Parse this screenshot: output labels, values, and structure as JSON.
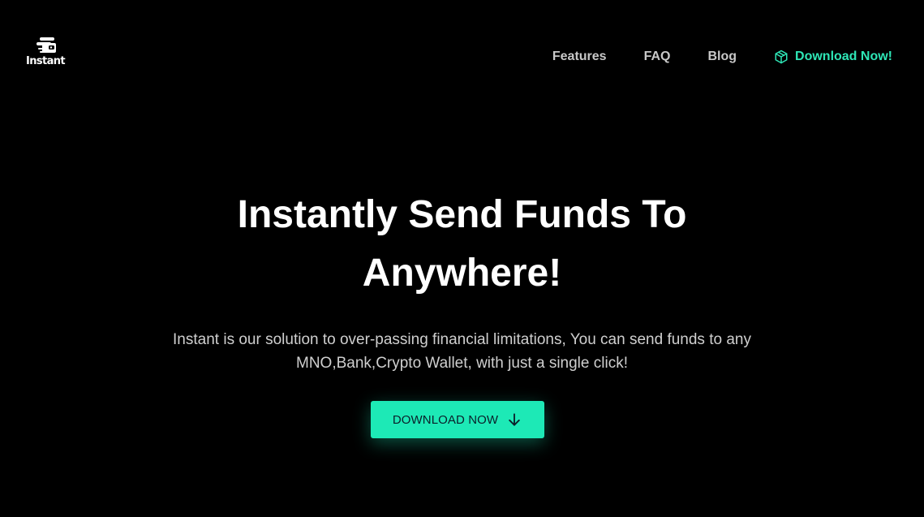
{
  "brand": {
    "name": "Instant",
    "logo_icon": "stacked-coins-wallet-icon"
  },
  "nav": {
    "items": [
      {
        "label": "Features"
      },
      {
        "label": "FAQ"
      },
      {
        "label": "Blog"
      }
    ],
    "download": {
      "label": "Download Now!",
      "icon": "package-icon"
    }
  },
  "hero": {
    "title_line1": "Instantly Send Funds To",
    "title_line2": "Anywhere!",
    "subtitle_line1": "Instant is our solution to over-passing financial limitations, You can send funds to any",
    "subtitle_line2": "MNO,Bank,Crypto Wallet, with just a single click!",
    "cta_label": "DOWNLOAD NOW",
    "cta_icon": "arrow-down-icon"
  },
  "colors": {
    "background": "#000000",
    "accent": "#1de9b6",
    "accent_text": "#2ee6b6",
    "nav_text": "#c8c8c8",
    "title_text": "#ffffff",
    "subtitle_text": "#cfcfcf"
  }
}
